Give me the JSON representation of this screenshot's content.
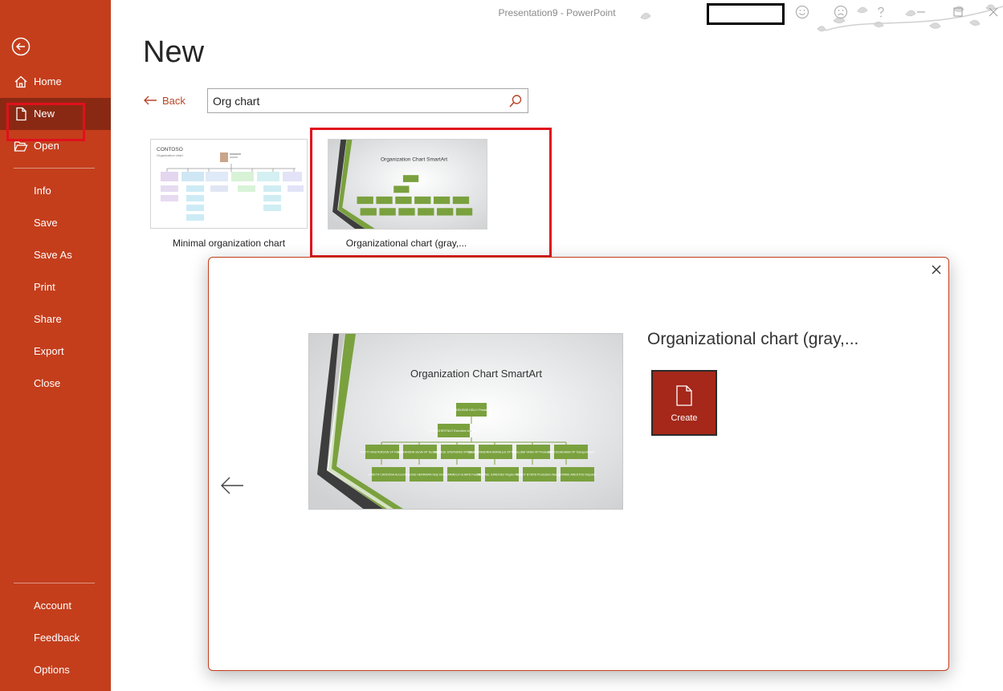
{
  "window": {
    "title": "Presentation9  -  PowerPoint"
  },
  "sidebar": {
    "items": [
      {
        "label": "Home",
        "icon": "home-icon"
      },
      {
        "label": "New",
        "icon": "new-document-icon"
      },
      {
        "label": "Open",
        "icon": "folder-open-icon"
      },
      {
        "label": "Info"
      },
      {
        "label": "Save"
      },
      {
        "label": "Save As"
      },
      {
        "label": "Print"
      },
      {
        "label": "Share"
      },
      {
        "label": "Export"
      },
      {
        "label": "Close"
      },
      {
        "label": "Account"
      },
      {
        "label": "Feedback"
      },
      {
        "label": "Options"
      }
    ],
    "selected": "New"
  },
  "main": {
    "title": "New",
    "back_label": "Back",
    "search": {
      "value": "Org chart"
    },
    "templates": [
      {
        "name": "Minimal organization chart",
        "thumb_company": "CONTOSO",
        "thumb_subtitle": "Organization chart"
      },
      {
        "name": "Organizational chart (gray,...",
        "thumb_title": "Organization Chart SmartArt"
      }
    ]
  },
  "dialog": {
    "title": "Organizational chart (gray,...",
    "preview_title": "Organization Chart SmartArt",
    "create_label": "Create",
    "org_boxes": {
      "top": "MADELEINE KELLY President",
      "second": "RYAN CHESTNUT Executive Assistant",
      "vps": [
        "SCOTT MASTERSON VP Finance",
        "ALEXANDRA SILVA VP Technology",
        "GEORGE STEPHENS VP Operations",
        "SVA ALEXANDRIA MORALES VP Marketing",
        "WILLIAM YAHN VP Production",
        "KIM YOSHIDAMA VP Transportation"
      ],
      "managers": [
        "JANETH CARDOSA Accounting",
        "JESSE HERRMAN Help Desk",
        "CARMELO GUARD Facilities",
        "MICHAEL SANCHEZ Region Manager",
        "RANDY BYERS Production Manager",
        "CONNIE ARESTOS Dispatch"
      ]
    }
  },
  "colors": {
    "sidebar": "#c43e1c",
    "sidebar_selected": "#8a2913",
    "highlight": "#e0111c",
    "create_button": "#a5281a",
    "org_green": "#7aa13e"
  }
}
